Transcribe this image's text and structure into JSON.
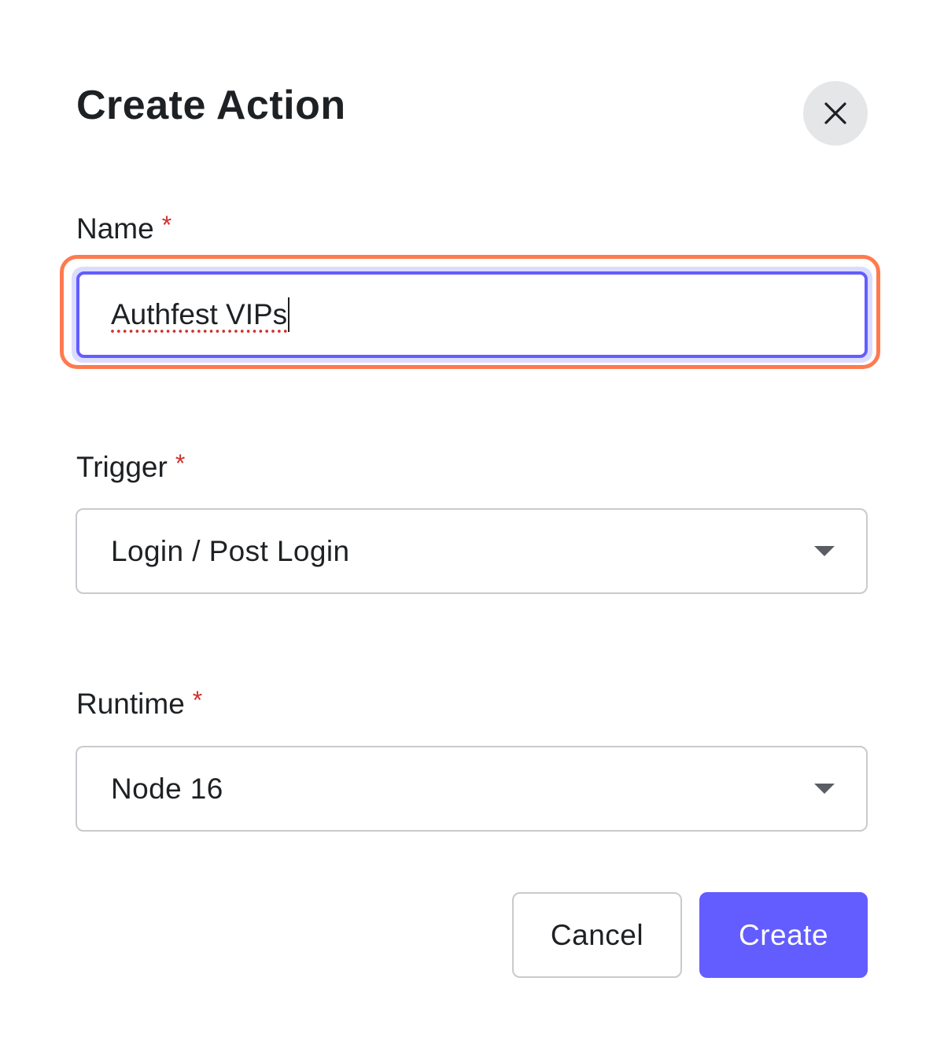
{
  "dialog": {
    "title": "Create Action",
    "close_icon": "close-icon"
  },
  "fields": {
    "name": {
      "label": "Name",
      "required_mark": "*",
      "value": "Authfest VIPs"
    },
    "trigger": {
      "label": "Trigger",
      "required_mark": "*",
      "selected": "Login / Post Login",
      "icon": "chevron-down-icon"
    },
    "runtime": {
      "label": "Runtime",
      "required_mark": "*",
      "selected": "Node 16",
      "icon": "chevron-down-icon"
    }
  },
  "actions": {
    "cancel_label": "Cancel",
    "create_label": "Create"
  },
  "colors": {
    "primary": "#635dff",
    "focus_outline": "#ff7a4f",
    "required": "#d0302c",
    "close_bg": "#e5e6e8",
    "border": "#c9cace"
  }
}
